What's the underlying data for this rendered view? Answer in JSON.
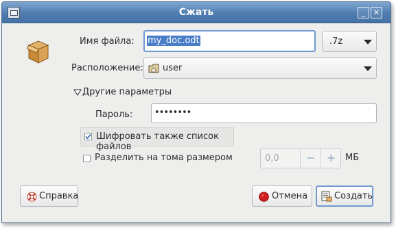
{
  "window": {
    "title": "Сжать"
  },
  "filename": {
    "label": "Имя файла:",
    "value": "my_doc.odt"
  },
  "format": {
    "selected": ".7z"
  },
  "location": {
    "label": "Расположение:",
    "value": "user"
  },
  "other_options": {
    "label": "Другие параметры"
  },
  "password": {
    "label": "Пароль:",
    "value": "••••••••"
  },
  "encrypt_list": {
    "label": "Шифровать также список файлов",
    "checked": true
  },
  "split": {
    "label": "Разделить на тома размером",
    "checked": false,
    "value": "0,0",
    "unit": "МБ",
    "minus": "−",
    "plus": "+"
  },
  "buttons": {
    "help": "Справка",
    "cancel": "Отмена",
    "create": "Создать"
  },
  "colors": {
    "titlebar": "#4f7db0",
    "selection": "#4a7dc8",
    "focus": "#6f9ad1"
  },
  "icons": [
    "archive-box-icon",
    "home-folder-icon",
    "help-lifebuoy-icon",
    "cancel-stop-icon",
    "create-archive-icon"
  ]
}
